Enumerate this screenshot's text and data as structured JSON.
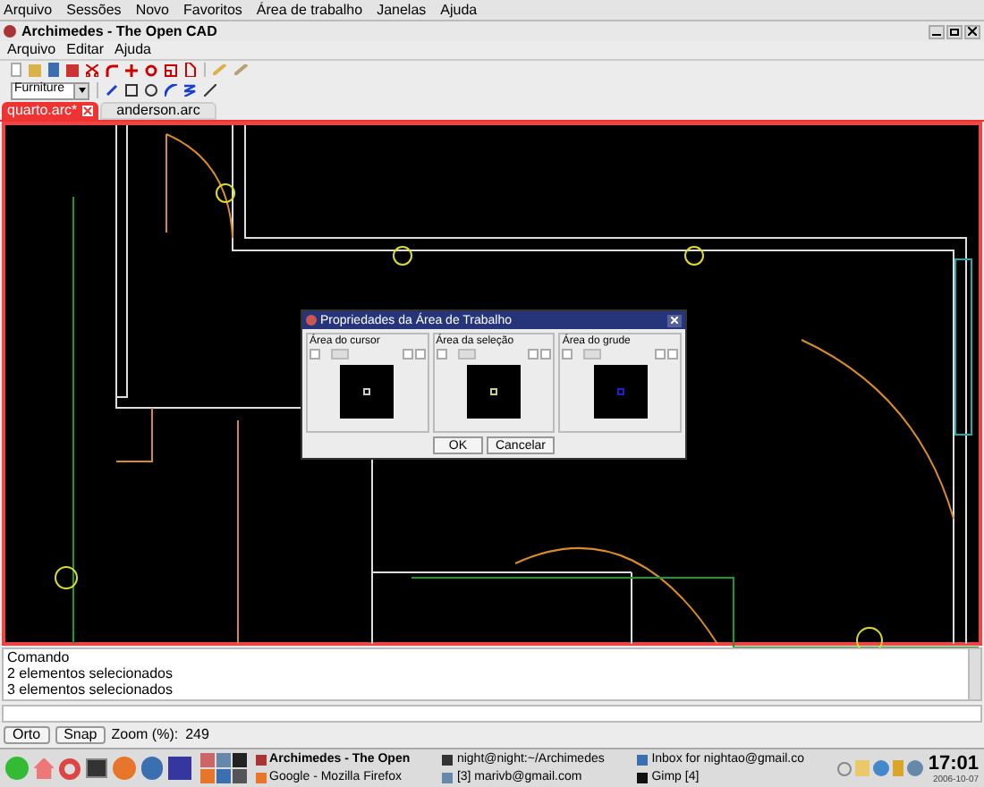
{
  "desktop_menu": [
    "Arquivo",
    "Sessões",
    "Novo",
    "Favoritos",
    "Área de trabalho",
    "Janelas",
    "Ajuda"
  ],
  "window": {
    "title": "Archimedes - The Open CAD"
  },
  "menu": [
    "Arquivo",
    "Editar",
    "Ajuda"
  ],
  "layer_combo": {
    "value": "Furniture"
  },
  "tabs": [
    {
      "label": "quarto.arc*",
      "selected": true
    },
    {
      "label": "anderson.arc",
      "selected": false
    }
  ],
  "dialog": {
    "title": "Propriedades da Área de Trabalho",
    "panels": [
      {
        "label": "Área do cursor",
        "kind": "cursor"
      },
      {
        "label": "Área da seleção",
        "kind": "selection"
      },
      {
        "label": "Área do grude",
        "kind": "grid"
      }
    ],
    "buttons": [
      "OK",
      "Cancelar"
    ]
  },
  "command_log": [
    "Comando",
    "2 elementos selecionados",
    "3 elementos selecionados"
  ],
  "status": {
    "buttons": [
      "Orto",
      "Snap"
    ],
    "zoom_label": "Zoom (%):",
    "zoom_value": "249"
  },
  "taskbar": {
    "tasks": [
      {
        "label": "Archimedes - The Open",
        "active": true
      },
      {
        "label": "Google - Mozilla Firefox",
        "active": false
      },
      {
        "label": "night@night:~/Archimedes",
        "active": false
      },
      {
        "label": "[3] marivb@gmail.com",
        "active": false
      },
      {
        "label": "Inbox for nightao@gmail.co",
        "active": false
      },
      {
        "label": "Gimp [4]",
        "active": false
      }
    ],
    "time": "17:01",
    "date": "2006-10-07"
  }
}
